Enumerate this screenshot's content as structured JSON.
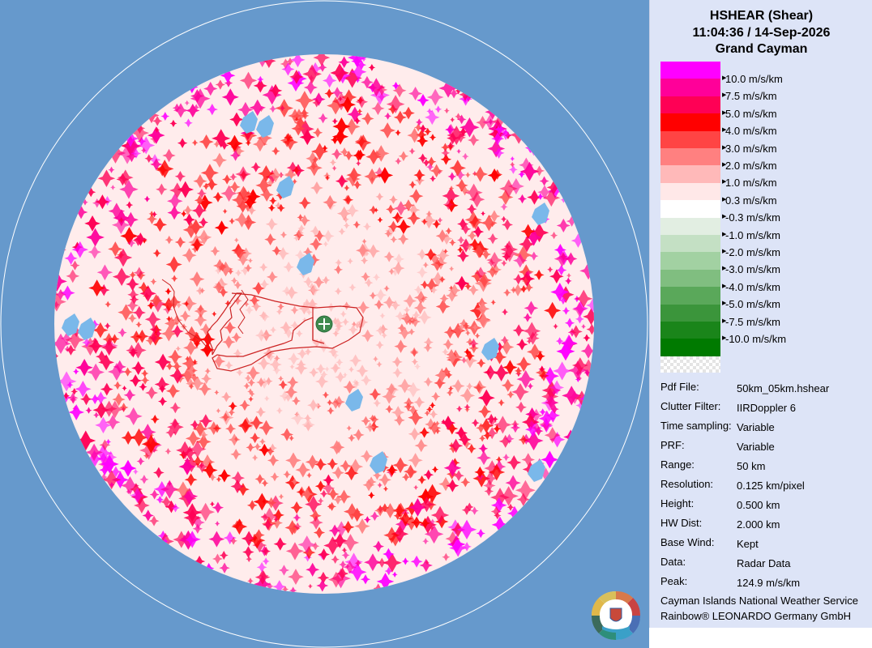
{
  "title": "HSHEAR (Shear)",
  "datetime": "11:04:36 / 14-Sep-2026",
  "location": "Grand Cayman",
  "legend": [
    {
      "label": "10.0 m/s/km",
      "color": "#ff00ff"
    },
    {
      "label": " 7.5 m/s/km",
      "color": "#ff0099"
    },
    {
      "label": " 5.0 m/s/km",
      "color": "#ff0055"
    },
    {
      "label": " 4.0 m/s/km",
      "color": "#ff0000"
    },
    {
      "label": " 3.0 m/s/km",
      "color": "#ff4444"
    },
    {
      "label": " 2.0 m/s/km",
      "color": "#ff8080"
    },
    {
      "label": " 1.0 m/s/km",
      "color": "#ffb9b9"
    },
    {
      "label": " 0.3 m/s/km",
      "color": "#ffe8e8"
    },
    {
      "label": "-0.3 m/s/km",
      "color": "#ffffff"
    },
    {
      "label": "-1.0 m/s/km",
      "color": "#e2eee2"
    },
    {
      "label": "-2.0 m/s/km",
      "color": "#c4e0c4"
    },
    {
      "label": "-3.0 m/s/km",
      "color": "#a2d1a2"
    },
    {
      "label": "-4.0 m/s/km",
      "color": "#80be80"
    },
    {
      "label": "-5.0 m/s/km",
      "color": "#5aa85a"
    },
    {
      "label": "-7.5 m/s/km",
      "color": "#3b953b"
    },
    {
      "label": "-10.0 m/s/km",
      "color": "#1a851a"
    },
    {
      "label": "",
      "color": "#007a00"
    }
  ],
  "info": [
    {
      "key": "Pdf File:",
      "value": "50km_05km.hshear"
    },
    {
      "key": "Clutter Filter:",
      "value": "IIRDoppler 6"
    },
    {
      "key": "Time sampling:",
      "value": "Variable"
    },
    {
      "key": "PRF:",
      "value": "Variable"
    },
    {
      "key": "Range:",
      "value": "50 km"
    },
    {
      "key": "Resolution:",
      "value": "0.125 km/pixel"
    },
    {
      "key": "Height:",
      "value": "0.500 km"
    },
    {
      "key": "HW Dist:",
      "value": "2.000 km"
    },
    {
      "key": "Base Wind:",
      "value": "Kept"
    },
    {
      "key": "Data:",
      "value": "Radar Data"
    },
    {
      "key": "Peak:",
      "value": "124.9 m/s/km"
    }
  ],
  "credits": [
    "Cayman Islands National Weather Service",
    "Rainbow® LEONARDO Germany GmbH"
  ],
  "colors": {
    "background": "#6699cc",
    "panel": "#dde4f7",
    "no_data": "#7ab8ea"
  },
  "icons": {
    "radar_site": "plus-circle-icon",
    "logo": "national-weather-service-logo"
  }
}
